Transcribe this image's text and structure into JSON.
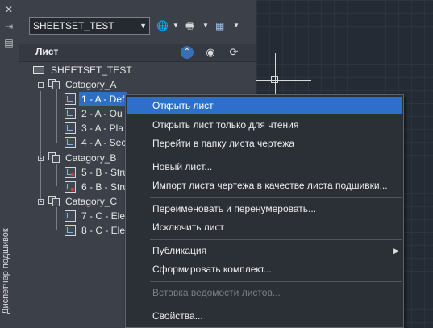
{
  "palette": {
    "vertical_title": "Диспетчер подшивок",
    "combo_value": "SHEETSET_TEST",
    "panel_title": "Лист",
    "toolbar_icons": [
      "globe-icon",
      "printer-icon",
      "sheetset-props-icon"
    ],
    "panel_icons": [
      "collapse-icon",
      "eye-icon",
      "refresh-icon"
    ]
  },
  "tree": {
    "root": "SHEETSET_TEST",
    "groups": [
      {
        "label": "Catagory_A",
        "sheets": [
          "1 - A - Def",
          "2 - A - Ou",
          "3 - A - Pla",
          "4 - A - Sec"
        ]
      },
      {
        "label": "Catagory_B",
        "sheets": [
          "5 - B - Stru",
          "6 - B - Stru"
        ]
      },
      {
        "label": "Catagory_C",
        "sheets": [
          "7 - C - Ele",
          "8 - C - Ele"
        ]
      }
    ]
  },
  "context_menu": {
    "items": [
      {
        "label": "Открыть лист",
        "state": "highlighted"
      },
      {
        "label": "Открыть лист только для чтения"
      },
      {
        "label": "Перейти в папку листа чертежа"
      },
      {
        "label": "Новый лист..."
      },
      {
        "label": "Импорт листа чертежа в качестве листа подшивки..."
      },
      {
        "label": "Переименовать и перенумеровать..."
      },
      {
        "label": "Исключить лист"
      },
      {
        "label": "Публикация",
        "submenu": true
      },
      {
        "label": "Сформировать комплект..."
      },
      {
        "label": "Вставка ведомости листов...",
        "state": "disabled"
      },
      {
        "label": "Свойства..."
      }
    ]
  },
  "colors": {
    "highlight": "#2e6fca",
    "selection": "#2f6fc2",
    "panel_bg": "#3b4049",
    "canvas_bg": "#252b34"
  }
}
